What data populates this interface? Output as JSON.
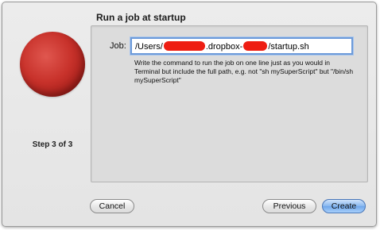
{
  "wizard": {
    "title": "Run a job at startup",
    "step": "Step 3 of 3"
  },
  "job": {
    "label": "Job:",
    "value_prefix": "/Users/",
    "value_middle": ".dropbox-",
    "value_suffix": "/startup.sh",
    "hint": "Write the command to run the job on one line just as you would in Terminal but include the full path, e.g. not \"sh mySuperScript\" but \"/bin/sh mySuperScript\""
  },
  "buttons": {
    "cancel": "Cancel",
    "previous": "Previous",
    "create": "Create"
  },
  "colors": {
    "accent": "#6fa6ea",
    "redaction": "#ee1d12"
  }
}
